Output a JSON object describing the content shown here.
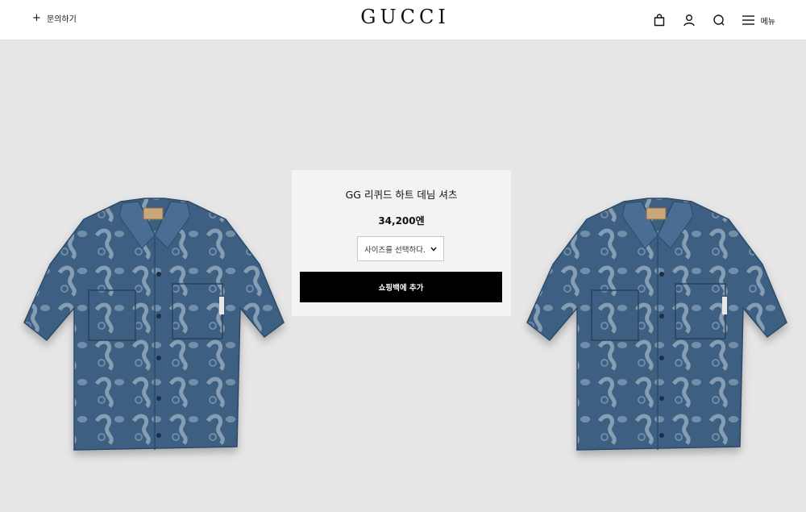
{
  "header": {
    "contact_label": "문의하기",
    "logo": "GUCCI",
    "menu_label": "메뉴",
    "icons": [
      "plus-icon",
      "shopping-bag-icon",
      "user-icon",
      "search-icon",
      "menu-icon"
    ]
  },
  "product": {
    "title": "GG 리퀴드 하트 데님 셔츠",
    "price": "34,200엔",
    "size_select": {
      "placeholder": "사이즈를 선택하다."
    },
    "add_to_bag_label": "쇼핑백에 추가"
  },
  "colors": {
    "page_background": "#e6e6e6",
    "panel_background": "#f3f3f3",
    "button_background": "#000000",
    "denim": "#3d5f82"
  }
}
